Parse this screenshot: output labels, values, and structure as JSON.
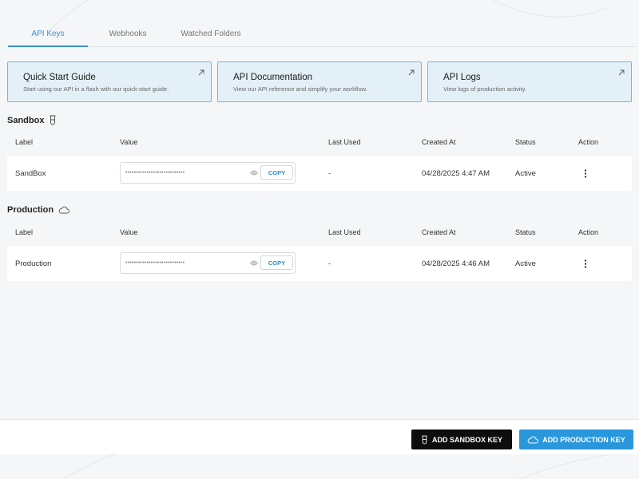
{
  "tabs": [
    {
      "label": "API Keys",
      "active": true
    },
    {
      "label": "Webhooks",
      "active": false
    },
    {
      "label": "Watched Folders",
      "active": false
    }
  ],
  "cards": [
    {
      "title": "Quick Start Guide",
      "description": "Start using our API in a flash with our quick-start guide.",
      "icon": "arrow-up-right-icon"
    },
    {
      "title": "API Documentation",
      "description": "View our API reference and simplify your workflow.",
      "icon": "arrow-up-right-icon"
    },
    {
      "title": "API Logs",
      "description": "View logs of production activity.",
      "icon": "arrow-up-right-icon"
    }
  ],
  "columns": [
    "Label",
    "Value",
    "Last Used",
    "Created At",
    "Status",
    "Action"
  ],
  "sandbox": {
    "title": "Sandbox",
    "icon": "test-tube-icon",
    "rows": [
      {
        "label": "SandBox",
        "value_masked": "••••••••••••••••••••••••••••",
        "copy_label": "COPY",
        "last_used": "-",
        "created_at": "04/28/2025 4:47 AM",
        "status": "Active",
        "action_icon": "kebab-icon"
      }
    ]
  },
  "production": {
    "title": "Production",
    "icon": "cloud-icon",
    "rows": [
      {
        "label": "Production",
        "value_masked": "••••••••••••••••••••••••••••",
        "copy_label": "COPY",
        "last_used": "-",
        "created_at": "04/28/2025 4:46 AM",
        "status": "Active",
        "action_icon": "kebab-icon"
      }
    ]
  },
  "footer": {
    "add_sandbox_label": "ADD SANDBOX KEY",
    "add_production_label": "ADD PRODUCTION KEY"
  },
  "colors": {
    "accent": "#2a96dc",
    "card_bg": "#e3f0f7",
    "card_border": "#7ab3d4",
    "page_bg": "#f5f6f7",
    "sandbox_button": "#0d0d0d"
  }
}
